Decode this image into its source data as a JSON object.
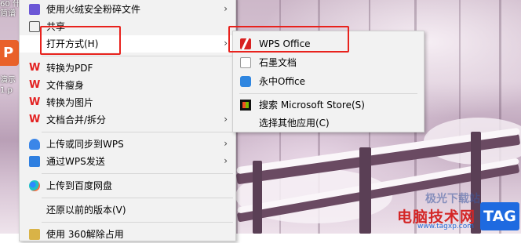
{
  "desktop": {
    "top_text": "60 什",
    "top_text2": "简谱",
    "ppt_letter": "P",
    "file_text1": "演示",
    "file_text2": "1.p"
  },
  "menu": {
    "items": [
      {
        "label": "使用火绒安全粉碎文件",
        "arrow": "›"
      },
      {
        "label": "共享"
      },
      {
        "label": "打开方式(H)",
        "arrow": "›"
      },
      {
        "label": "转换为PDF"
      },
      {
        "label": "文件瘦身"
      },
      {
        "label": "转换为图片"
      },
      {
        "label": "文档合并/拆分",
        "arrow": "›"
      },
      {
        "label": "上传或同步到WPS",
        "arrow": "›"
      },
      {
        "label": "通过WPS发送",
        "arrow": "›"
      },
      {
        "label": "上传到百度网盘"
      },
      {
        "label": "还原以前的版本(V)"
      },
      {
        "label": "使用 360解除占用"
      }
    ],
    "icons": {
      "shred": "file-shredder-icon",
      "share": "share-icon",
      "pdf": "wps-icon",
      "slim": "wps-icon",
      "img": "wps-icon",
      "merge": "wps-icon",
      "upload": "cloud-upload-icon",
      "send": "send-icon",
      "baidu": "baidu-netdisk-icon",
      "unlock": "360-icon"
    },
    "wps_glyph": "W"
  },
  "submenu": {
    "items": [
      {
        "label": "WPS Office",
        "icon": "wps-office-icon"
      },
      {
        "label": "石墨文档",
        "icon": "shimo-docs-icon"
      },
      {
        "label": "永中Office",
        "icon": "yozo-office-icon"
      },
      {
        "label": "搜索 Microsoft Store(S)",
        "icon": "microsoft-store-icon"
      },
      {
        "label": "选择其他应用(C)"
      }
    ]
  },
  "watermark": {
    "text": "电脑技术网",
    "url": "www.tagxp.com",
    "tag": "TAG",
    "faint": "极光下载站"
  },
  "colors": {
    "highlight": "#e8221d",
    "menu_bg": "#f2f2f2",
    "wps_red": "#e32121"
  }
}
